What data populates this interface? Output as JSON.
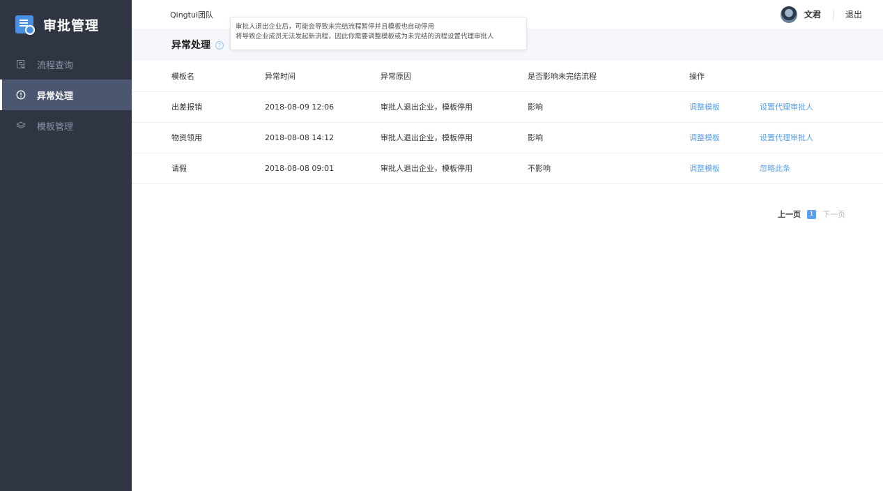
{
  "sidebar": {
    "brand": "审批管理",
    "items": [
      {
        "label": "流程查询",
        "icon": "search-doc-icon"
      },
      {
        "label": "异常处理",
        "icon": "alert-clock-icon",
        "active": true
      },
      {
        "label": "模板管理",
        "icon": "layers-icon"
      }
    ]
  },
  "header": {
    "team": "Qingtui团队",
    "username": "文君",
    "logout": "退出"
  },
  "page": {
    "title": "异常处理",
    "tooltip_line1": "审批人退出企业后，可能会导致未完结流程暂停并且模板也自动停用",
    "tooltip_line2": "将导致企业成员无法发起新流程，因此你需要调整模板或为未完结的流程设置代理审批人"
  },
  "table": {
    "headers": [
      "模板名",
      "异常时间",
      "异常原因",
      "是否影响未完结流程",
      "操作"
    ],
    "rows": [
      {
        "name": "出差报销",
        "time": "2018-08-09 12:06",
        "reason": "审批人退出企业，模板停用",
        "affect": "影响",
        "op1": "调整模板",
        "op2": "设置代理审批人"
      },
      {
        "name": "物资领用",
        "time": "2018-08-08 14:12",
        "reason": "审批人退出企业，模板停用",
        "affect": "影响",
        "op1": "调整模板",
        "op2": "设置代理审批人"
      },
      {
        "name": "请假",
        "time": "2018-08-08 09:01",
        "reason": "审批人退出企业，模板停用",
        "affect": "不影响",
        "op1": "调整模板",
        "op2": "忽略此条"
      }
    ]
  },
  "pagination": {
    "prev": "上一页",
    "current": "1",
    "next": "下一页"
  },
  "colors": {
    "sidebar_bg": "#2f3542",
    "active_bg": "#4b5670",
    "link": "#5aa0ec",
    "brand_icon": "#4a90e2"
  }
}
